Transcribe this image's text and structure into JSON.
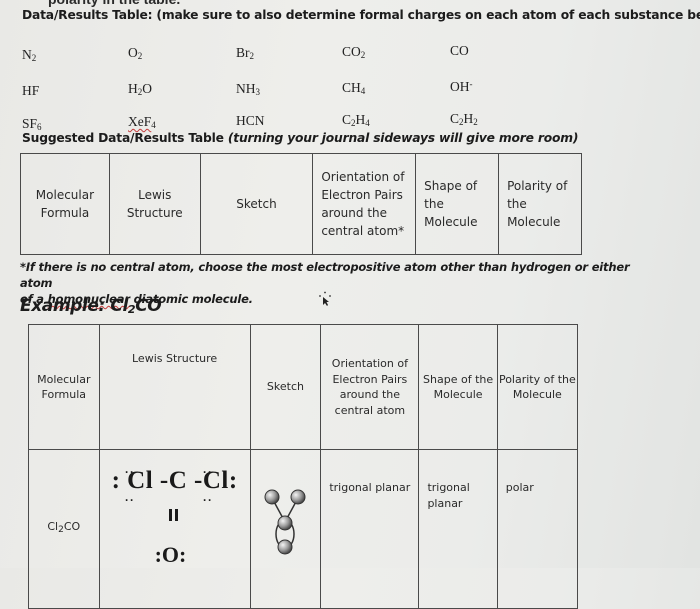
{
  "cut_off_text": "polarity in the table.",
  "heading": {
    "bold": "Data/Results Table:  (make sure to also determine formal charges on each atom of each substance below)."
  },
  "formulas": [
    [
      {
        "base": "N",
        "sub": "2"
      },
      {
        "base": "O",
        "sub": "2"
      },
      {
        "base": "Br",
        "sub": "2"
      },
      {
        "base": "CO",
        "sub": "2"
      },
      {
        "base": "CO",
        "sub": ""
      }
    ],
    [
      {
        "base": "HF",
        "sub": ""
      },
      {
        "base": "H",
        "sub": "2",
        "tail": "O"
      },
      {
        "base": "NH",
        "sub": "3"
      },
      {
        "base": "CH",
        "sub": "4"
      },
      {
        "base": "OH",
        "sup": "-"
      }
    ],
    [
      {
        "base": "SF",
        "sub": "6"
      },
      {
        "base": "XeF",
        "sub": "4"
      },
      {
        "base": "HCN",
        "sub": ""
      },
      {
        "base": "C",
        "sub": "2",
        "tail": "H",
        "sub2": "4"
      },
      {
        "base": "C",
        "sub": "2",
        "tail": "H",
        "sub2": "2"
      }
    ]
  ],
  "suggested": {
    "title_bold": "Suggested Data/Results Table ",
    "title_italic": "(turning your journal sideways will give more room)",
    "headers": [
      "Molecular Formula",
      "Lewis Structure",
      "Sketch",
      "Orientation of Electron Pairs around the central atom*",
      "Shape of the Molecule",
      "Polarity of the Molecule"
    ]
  },
  "footnote": {
    "line1": "*If there is no central atom, choose the most electropositive atom other than hydrogen or either atom",
    "line2_pre": "of a ",
    "line2_squiggle": "homonuclear",
    "line2_post": " diatomic molecule."
  },
  "example": {
    "title_pre": "Example: Cl",
    "title_sub": "2",
    "title_post": "CO",
    "headers": [
      "Molecular Formula",
      "Lewis Structure",
      "Sketch",
      "Orientation of Electron Pairs around the central atom",
      "Shape of the Molecule",
      "Polarity of the Molecule"
    ],
    "row": {
      "formula_pre": "Cl",
      "formula_sub": "2",
      "formula_post": "CO",
      "lewis_top": ": Cl -C -Cl:",
      "lewis_bottom": ":O:",
      "orientation": "trigonal planar",
      "shape": "trigonal planar",
      "polarity": "polar"
    }
  }
}
